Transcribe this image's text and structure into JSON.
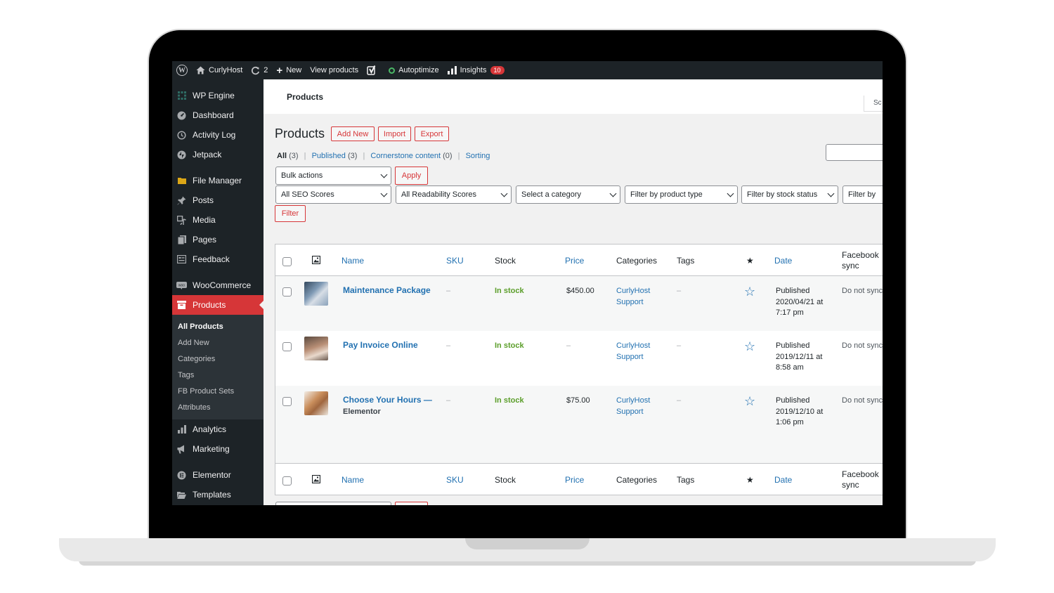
{
  "adminbar": {
    "site_name": "CurlyHost",
    "updates_count": "2",
    "new_label": "New",
    "view_products": "View products",
    "autoptimize": "Autoptimize",
    "insights": "Insights",
    "insights_badge": "10"
  },
  "sidebar": {
    "items": [
      {
        "label": "WP Engine",
        "icon": "wp-engine-icon"
      },
      {
        "label": "Dashboard",
        "icon": "dashboard-icon"
      },
      {
        "label": "Activity Log",
        "icon": "history-icon"
      },
      {
        "label": "Jetpack",
        "icon": "jetpack-icon"
      },
      {
        "label": "File Manager",
        "icon": "folder-icon"
      },
      {
        "label": "Posts",
        "icon": "pin-icon"
      },
      {
        "label": "Media",
        "icon": "media-icon"
      },
      {
        "label": "Pages",
        "icon": "pages-icon"
      },
      {
        "label": "Feedback",
        "icon": "feedback-icon"
      },
      {
        "label": "WooCommerce",
        "icon": "woo-icon"
      },
      {
        "label": "Products",
        "icon": "products-icon"
      },
      {
        "label": "Analytics",
        "icon": "bar-chart-icon"
      },
      {
        "label": "Marketing",
        "icon": "megaphone-icon"
      },
      {
        "label": "Elementor",
        "icon": "elementor-icon"
      },
      {
        "label": "Templates",
        "icon": "folder-open-icon"
      }
    ],
    "submenu": [
      "All Products",
      "Add New",
      "Categories",
      "Tags",
      "FB Product Sets",
      "Attributes"
    ]
  },
  "header": {
    "title": "Products",
    "screen_options": "Sc"
  },
  "main": {
    "page_title": "Products",
    "add_new": "Add New",
    "import": "Import",
    "export": "Export",
    "views": {
      "all": "All",
      "all_count": "(3)",
      "published": "Published",
      "published_count": "(3)",
      "cornerstone": "Cornerstone content",
      "cornerstone_count": "(0)",
      "sorting": "Sorting",
      "separator": "|"
    },
    "bulk_actions": "Bulk actions",
    "apply": "Apply",
    "filters": {
      "seo": "All SEO Scores",
      "readability": "All Readability Scores",
      "category": "Select a category",
      "product_type": "Filter by product type",
      "stock_status": "Filter by stock status",
      "more": "Filter by"
    },
    "filter_button": "Filter"
  },
  "table": {
    "columns": [
      "Name",
      "SKU",
      "Stock",
      "Price",
      "Categories",
      "Tags",
      "Date",
      "Facebook",
      "sync"
    ],
    "rows": [
      {
        "name": "Maintenance Package",
        "name_sub": "",
        "sku": "–",
        "stock": "In stock",
        "price": "$450.00",
        "cat1": "CurlyHost",
        "cat2": "Support",
        "tags": "–",
        "date1": "Published",
        "date2": "2020/04/21 at",
        "date3": "7:17 pm",
        "fb": "Do not sync"
      },
      {
        "name": "Pay Invoice Online",
        "name_sub": "",
        "sku": "–",
        "stock": "In stock",
        "price": "–",
        "cat1": "CurlyHost",
        "cat2": "Support",
        "tags": "–",
        "date1": "Published",
        "date2": "2019/12/11 at",
        "date3": "8:58 am",
        "fb": "Do not sync"
      },
      {
        "name": "Choose Your Hours —",
        "name_sub": "Elementor",
        "sku": "–",
        "stock": "In stock",
        "price": "$75.00",
        "cat1": "CurlyHost",
        "cat2": "Support",
        "tags": "–",
        "date1": "Published",
        "date2": "2019/12/10 at",
        "date3": "1:06 pm",
        "fb": "Do not sync"
      }
    ]
  },
  "colors": {
    "admin_bar": "#1d2327",
    "accent_red": "#d63638",
    "link_blue": "#2271b1",
    "in_stock_green": "#5b9e2a"
  }
}
